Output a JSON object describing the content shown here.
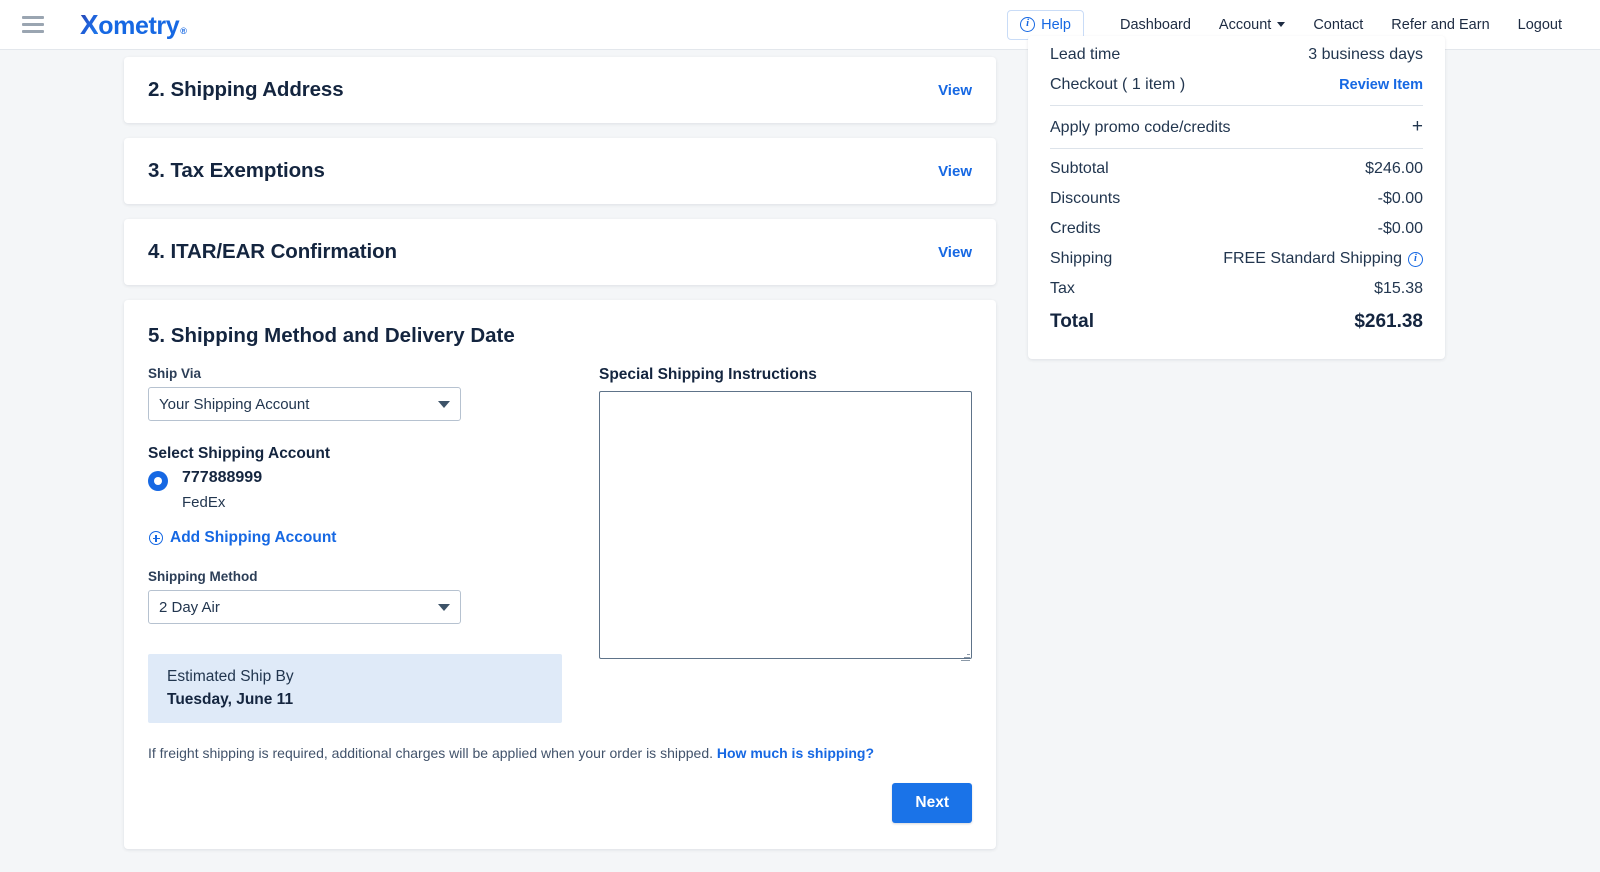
{
  "header": {
    "menu_icon": "hamburger-icon",
    "logo": {
      "x": "X",
      "rest": "ometry",
      "tm": "®"
    },
    "help_label": "Help",
    "nav": [
      {
        "label": "Dashboard",
        "has_caret": false
      },
      {
        "label": "Account",
        "has_caret": true
      },
      {
        "label": "Contact",
        "has_caret": false
      },
      {
        "label": "Refer and Earn",
        "has_caret": false
      },
      {
        "label": "Logout",
        "has_caret": false
      }
    ]
  },
  "steps": [
    {
      "title": "2. Shipping Address",
      "action": "View"
    },
    {
      "title": "3. Tax Exemptions",
      "action": "View"
    },
    {
      "title": "4. ITAR/EAR Confirmation",
      "action": "View"
    }
  ],
  "shipping_section": {
    "title": "5. Shipping Method and Delivery Date",
    "ship_via": {
      "label": "Ship Via",
      "value": "Your Shipping Account"
    },
    "select_account": {
      "label": "Select Shipping Account",
      "account_number": "777888999",
      "carrier": "FedEx",
      "add_link": "Add Shipping Account"
    },
    "shipping_method": {
      "label": "Shipping Method",
      "value": "2 Day Air"
    },
    "estimated": {
      "label": "Estimated Ship By",
      "date": "Tuesday, June 11"
    },
    "instructions": {
      "label": "Special Shipping Instructions",
      "value": "",
      "placeholder": ""
    },
    "footnote_text": "If freight shipping is required, additional charges will be applied when your order is shipped.",
    "footnote_link": "How much is shipping?",
    "next_label": "Next"
  },
  "summary": {
    "lead_time": {
      "label": "Lead time",
      "value": "3 business days"
    },
    "checkout": {
      "label": "Checkout ( 1 item )",
      "action": "Review Item"
    },
    "promo": {
      "label": "Apply promo code/credits",
      "toggle": "+"
    },
    "lines": [
      {
        "label": "Subtotal",
        "value": "$246.00"
      },
      {
        "label": "Discounts",
        "value": "-$0.00"
      },
      {
        "label": "Credits",
        "value": "-$0.00"
      }
    ],
    "shipping": {
      "label": "Shipping",
      "value": "FREE Standard Shipping"
    },
    "tax": {
      "label": "Tax",
      "value": "$15.38"
    },
    "total": {
      "label": "Total",
      "value": "$261.38"
    }
  },
  "colors": {
    "brand_blue": "#1668e3",
    "button_blue": "#1a73e8",
    "info_box": "#dfeaf8",
    "page_bg": "#f4f6f8"
  }
}
